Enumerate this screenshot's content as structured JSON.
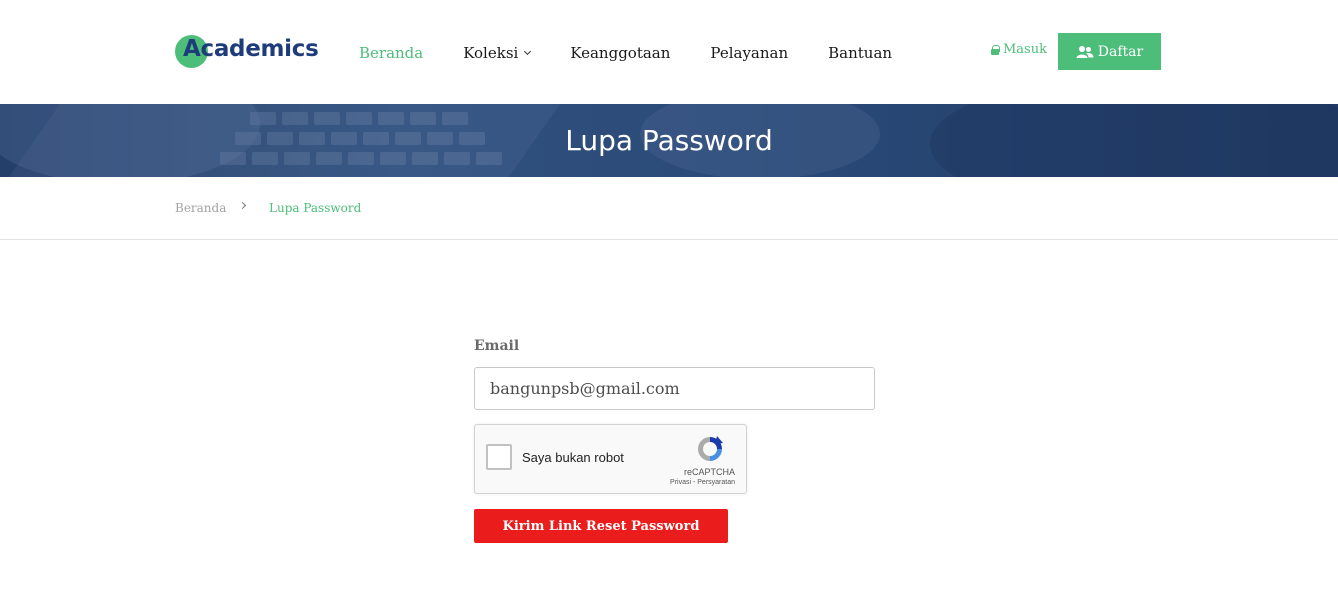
{
  "brand": {
    "name": "Academics",
    "accent": "#4cbe7a",
    "dark": "#1f3c7a"
  },
  "nav": {
    "items": [
      {
        "label": "Beranda",
        "active": true
      },
      {
        "label": "Koleksi",
        "dropdown": true
      },
      {
        "label": "Keanggotaan"
      },
      {
        "label": "Pelayanan"
      },
      {
        "label": "Bantuan"
      }
    ],
    "login_label": "Masuk",
    "register_label": "Daftar"
  },
  "banner": {
    "title": "Lupa Password"
  },
  "breadcrumb": {
    "home": "Beranda",
    "current": "Lupa Password"
  },
  "form": {
    "email_label": "Email",
    "email_value": "bangunpsb@gmail.com",
    "recaptcha": {
      "label": "Saya bukan robot",
      "brand": "reCAPTCHA",
      "terms": "Privasi - Persyaratan"
    },
    "submit_label": "Kirim Link Reset Password",
    "submit_color": "#ea1c1c"
  }
}
